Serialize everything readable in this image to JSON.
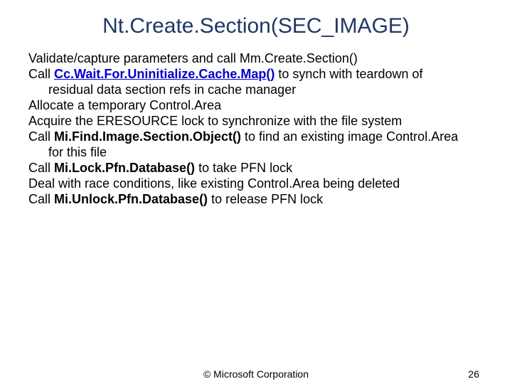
{
  "title": "Nt.Create.Section(SEC_IMAGE)",
  "lines": {
    "l1": "Validate/capture parameters and call Mm.Create.Section()",
    "l2a": "Call ",
    "l2b": "Cc.Wait.For.Uninitialize.Cache.Map()",
    "l2c": " to synch with teardown of",
    "l3": "residual data section refs in cache manager",
    "l4": "Allocate a temporary Control.Area",
    "l5": "Acquire the ERESOURCE lock to synchronize with the file system",
    "l6a": "Call ",
    "l6b": "Mi.Find.Image.Section.Object()",
    "l6c": " to find an existing image Control.Area",
    "l7": "for this file",
    "l8a": "Call ",
    "l8b": "Mi.Lock.Pfn.Database()",
    "l8c": " to take PFN lock",
    "l9": "Deal with race conditions, like existing Control.Area being deleted",
    "l10a": "Call ",
    "l10b": "Mi.Unlock.Pfn.Database()",
    "l10c": " to release PFN lock"
  },
  "footer": {
    "copyright": "© Microsoft Corporation",
    "page": "26"
  }
}
